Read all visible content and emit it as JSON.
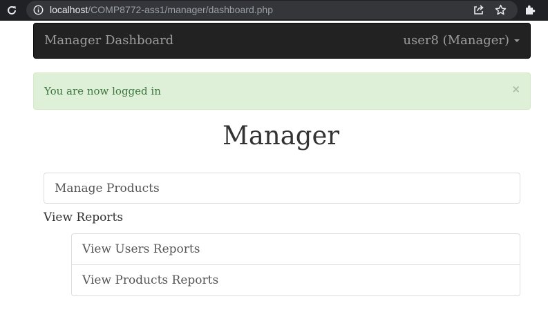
{
  "browser": {
    "url_host": "localhost",
    "url_path": "/COMP8772-ass1/manager/dashboard.php",
    "icons": [
      "reload-icon",
      "info-icon",
      "share-icon",
      "star-icon",
      "extensions-icon"
    ]
  },
  "navbar": {
    "brand": "Manager Dashboard",
    "user_menu": "user8 (Manager)"
  },
  "alert": {
    "message": "You are now logged in",
    "close": "×"
  },
  "page": {
    "title": "Manager"
  },
  "menu": {
    "manage_products": "Manage Products",
    "view_reports_label": "View Reports",
    "reports": [
      {
        "label": "View Users Reports"
      },
      {
        "label": "View Products Reports"
      }
    ]
  },
  "colors": {
    "navbar_bg": "#222222",
    "navbar_text": "#9d9d9d",
    "alert_bg": "#dff0d8",
    "alert_text": "#3c763d",
    "list_border": "#dddddd"
  }
}
